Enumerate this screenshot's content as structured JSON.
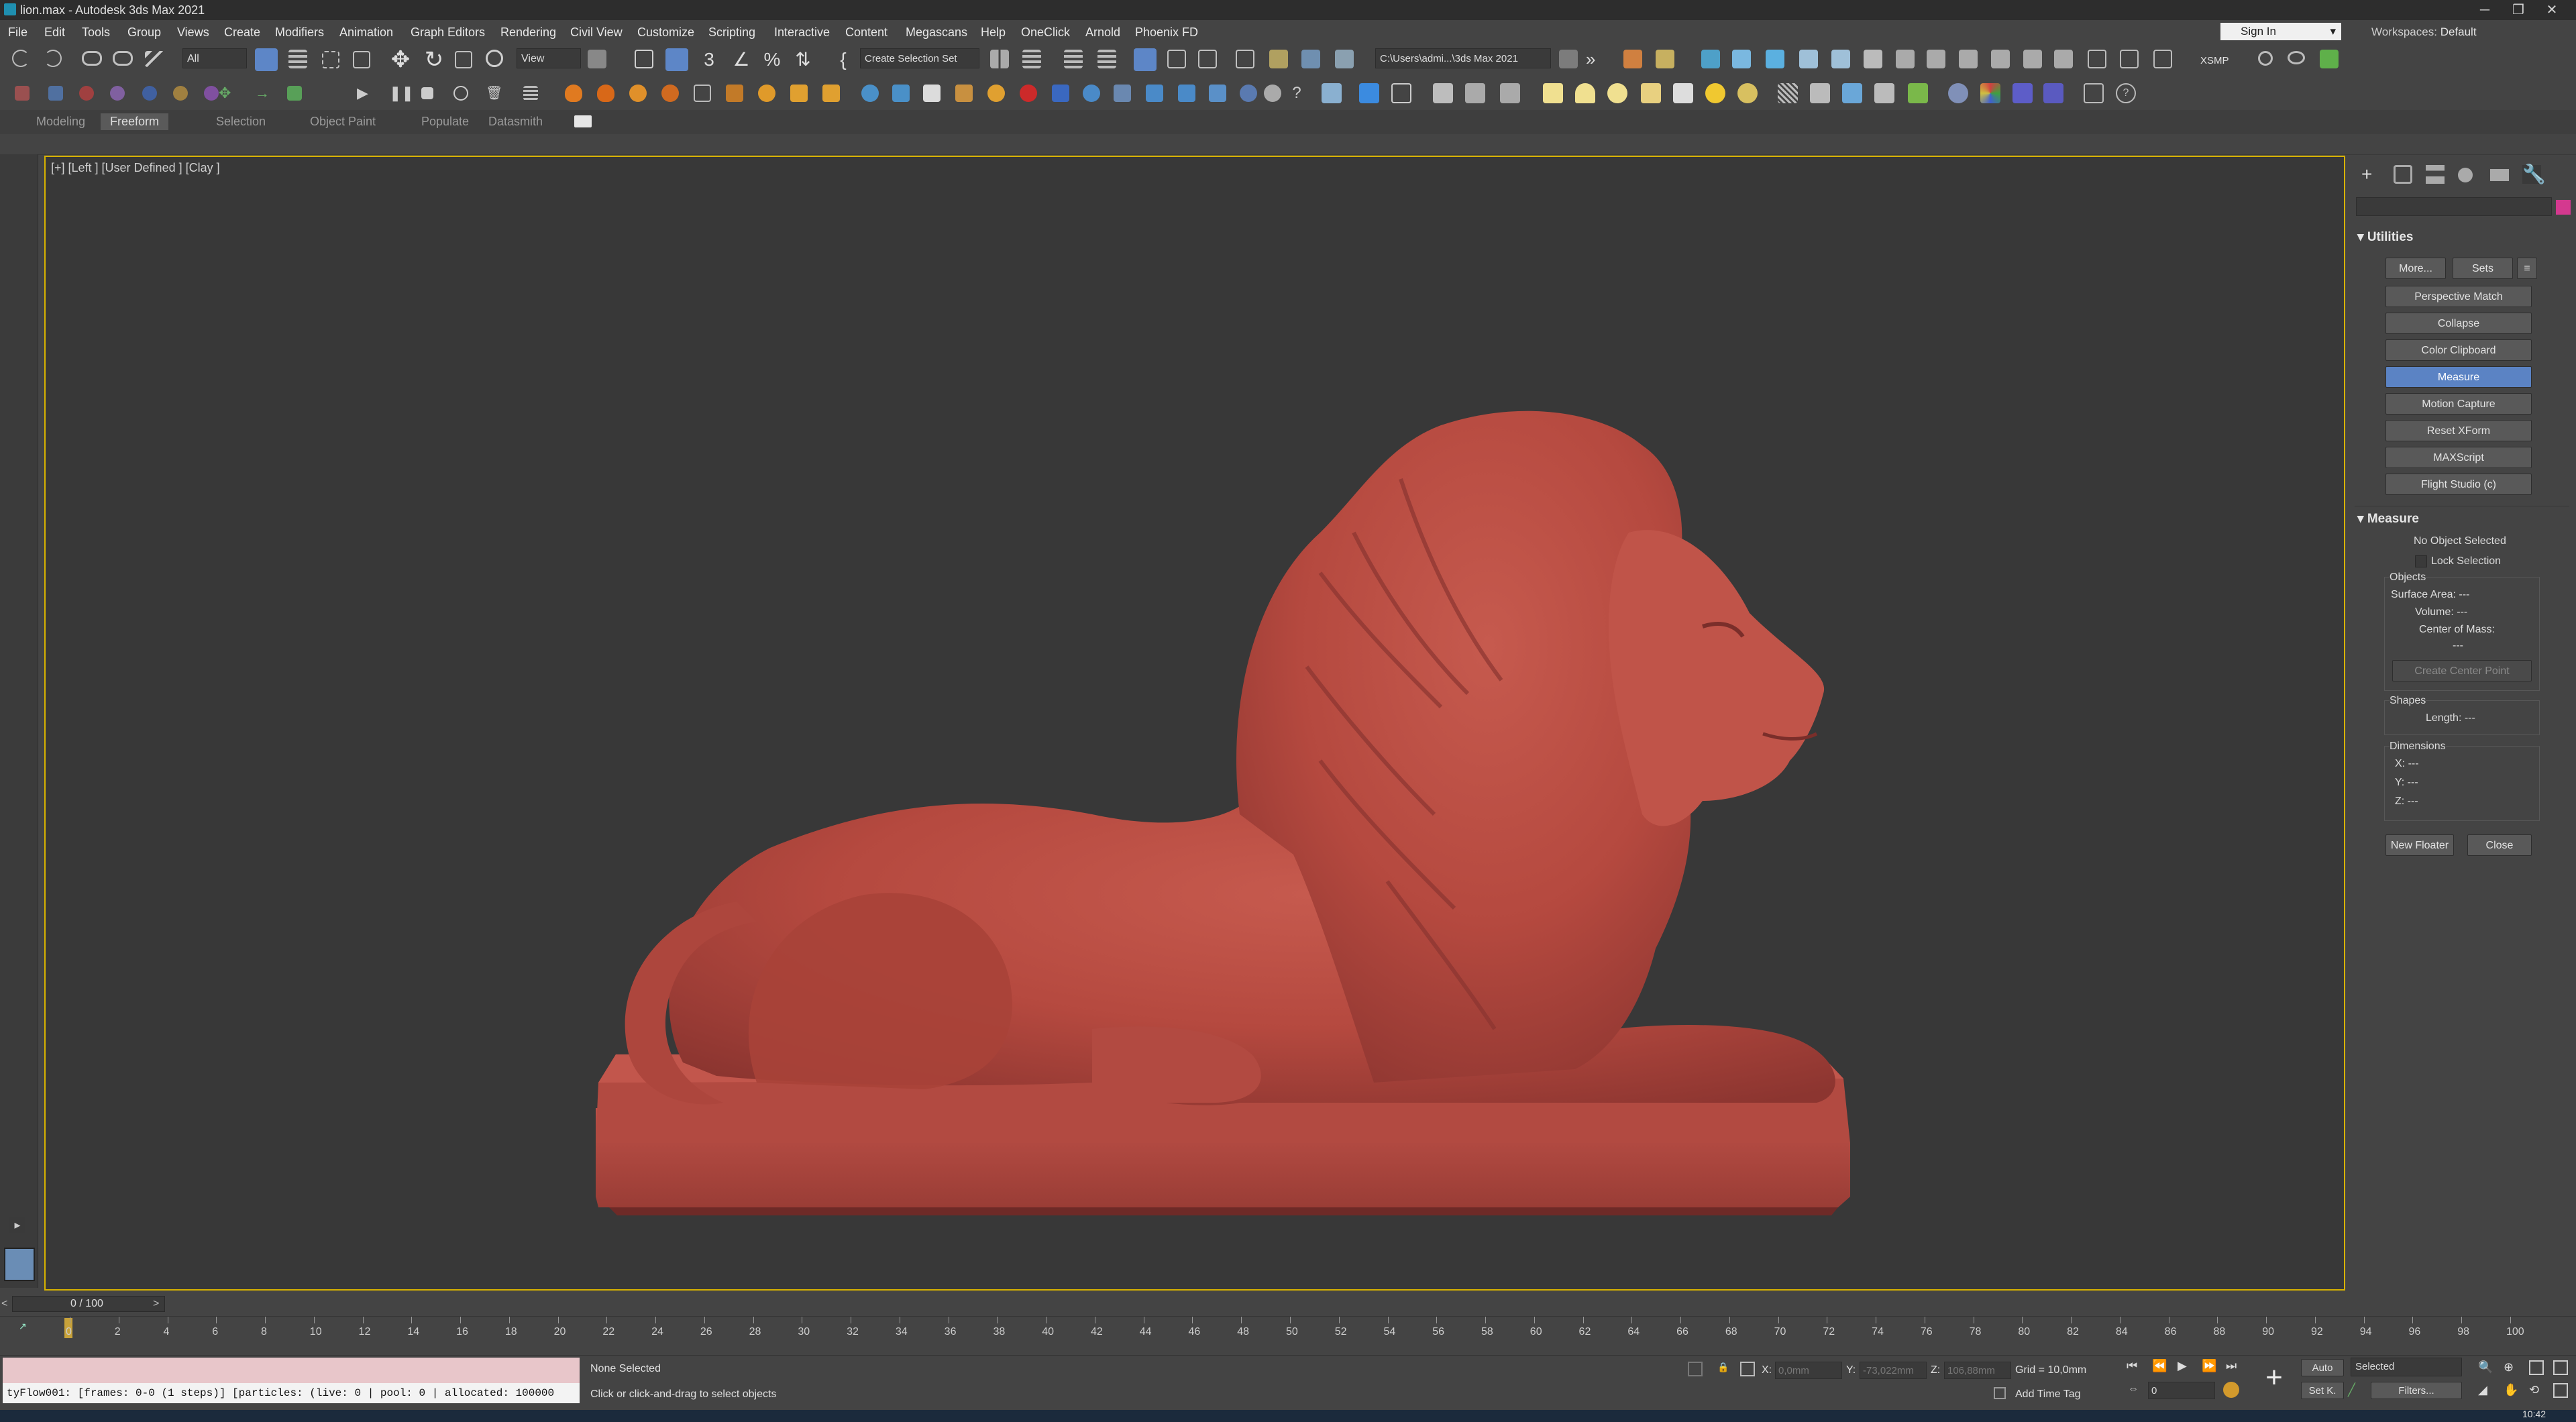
{
  "window": {
    "title": "lion.max - Autodesk 3ds Max 2021",
    "minimize_glyph": "─",
    "restore_glyph": "❐",
    "close_glyph": "✕"
  },
  "menu": {
    "items": [
      "File",
      "Edit",
      "Tools",
      "Group",
      "Views",
      "Create",
      "Modifiers",
      "Animation",
      "Graph Editors",
      "Rendering",
      "Civil View",
      "Customize",
      "Scripting",
      "Interactive",
      "Content",
      "Megascans",
      "Help",
      "OneClick",
      "Arnold",
      "Phoenix FD"
    ],
    "sign_in": "Sign In",
    "workspaces_label": "Workspaces:",
    "workspaces_value": "Default"
  },
  "toolbar": {
    "selection_filter": "All",
    "ref_coord": "View",
    "named_selection": "Create Selection Set",
    "project_path": "C:\\Users\\admi...\\3ds Max 2021",
    "xsmp": "XSMP"
  },
  "ribbon": {
    "tabs": [
      "Modeling",
      "Freeform",
      "Selection",
      "Object Paint",
      "Populate",
      "Datasmith"
    ],
    "active_tab": "Freeform"
  },
  "viewport": {
    "label": "[+] [Left ] [User Defined ] [Clay ]",
    "model_color": "#b5493f",
    "background_color": "#383838",
    "active_border": "#d7b200"
  },
  "command_panel": {
    "utilities_title": "Utilities",
    "more_label": "More...",
    "sets_label": "Sets",
    "utility_buttons": [
      "Perspective Match",
      "Collapse",
      "Color Clipboard",
      "Measure",
      "Motion Capture",
      "Reset XForm",
      "MAXScript",
      "Flight Studio (c)"
    ],
    "active_utility": "Measure",
    "measure": {
      "title": "Measure",
      "status": "No Object Selected",
      "lock_selection": "Lock Selection",
      "objects_label": "Objects",
      "surface_area": "Surface Area: ---",
      "volume": "Volume: ---",
      "center_of_mass": "Center of Mass:",
      "center_value": "---",
      "create_center_point": "Create Center Point",
      "shapes_label": "Shapes",
      "length": "Length: ---",
      "dimensions_label": "Dimensions",
      "x": "X: ---",
      "y": "Y: ---",
      "z": "Z: ---",
      "new_floater": "New Floater",
      "close": "Close"
    }
  },
  "timeline": {
    "slider_text": "0 / 100",
    "ticks": [
      "0",
      "2",
      "4",
      "6",
      "8",
      "10",
      "12",
      "14",
      "16",
      "18",
      "20",
      "22",
      "24",
      "26",
      "28",
      "30",
      "32",
      "34",
      "36",
      "38",
      "40",
      "42",
      "44",
      "46",
      "48",
      "50",
      "52",
      "54",
      "56",
      "58",
      "60",
      "62",
      "64",
      "66",
      "68",
      "70",
      "72",
      "74",
      "76",
      "78",
      "80",
      "82",
      "84",
      "86",
      "88",
      "90",
      "92",
      "94",
      "96",
      "98",
      "100"
    ]
  },
  "status": {
    "script_output": "tyFlow001: [frames: 0-0 (1 steps)] [particles: (live: 0 | pool: 0 | allocated: 100000",
    "selection": "None Selected",
    "prompt": "Click or click-and-drag to select objects",
    "x_label": "X:",
    "x_value": "0,0mm",
    "y_label": "Y:",
    "y_value": "-73,022mm",
    "z_label": "Z:",
    "z_value": "106,88mm",
    "grid": "Grid = 10,0mm",
    "add_time_tag": "Add Time Tag",
    "auto": "Auto",
    "set_key": "Set K.",
    "key_filter": "Selected",
    "filters": "Filters...",
    "frame": "0",
    "clock": "10:42"
  }
}
